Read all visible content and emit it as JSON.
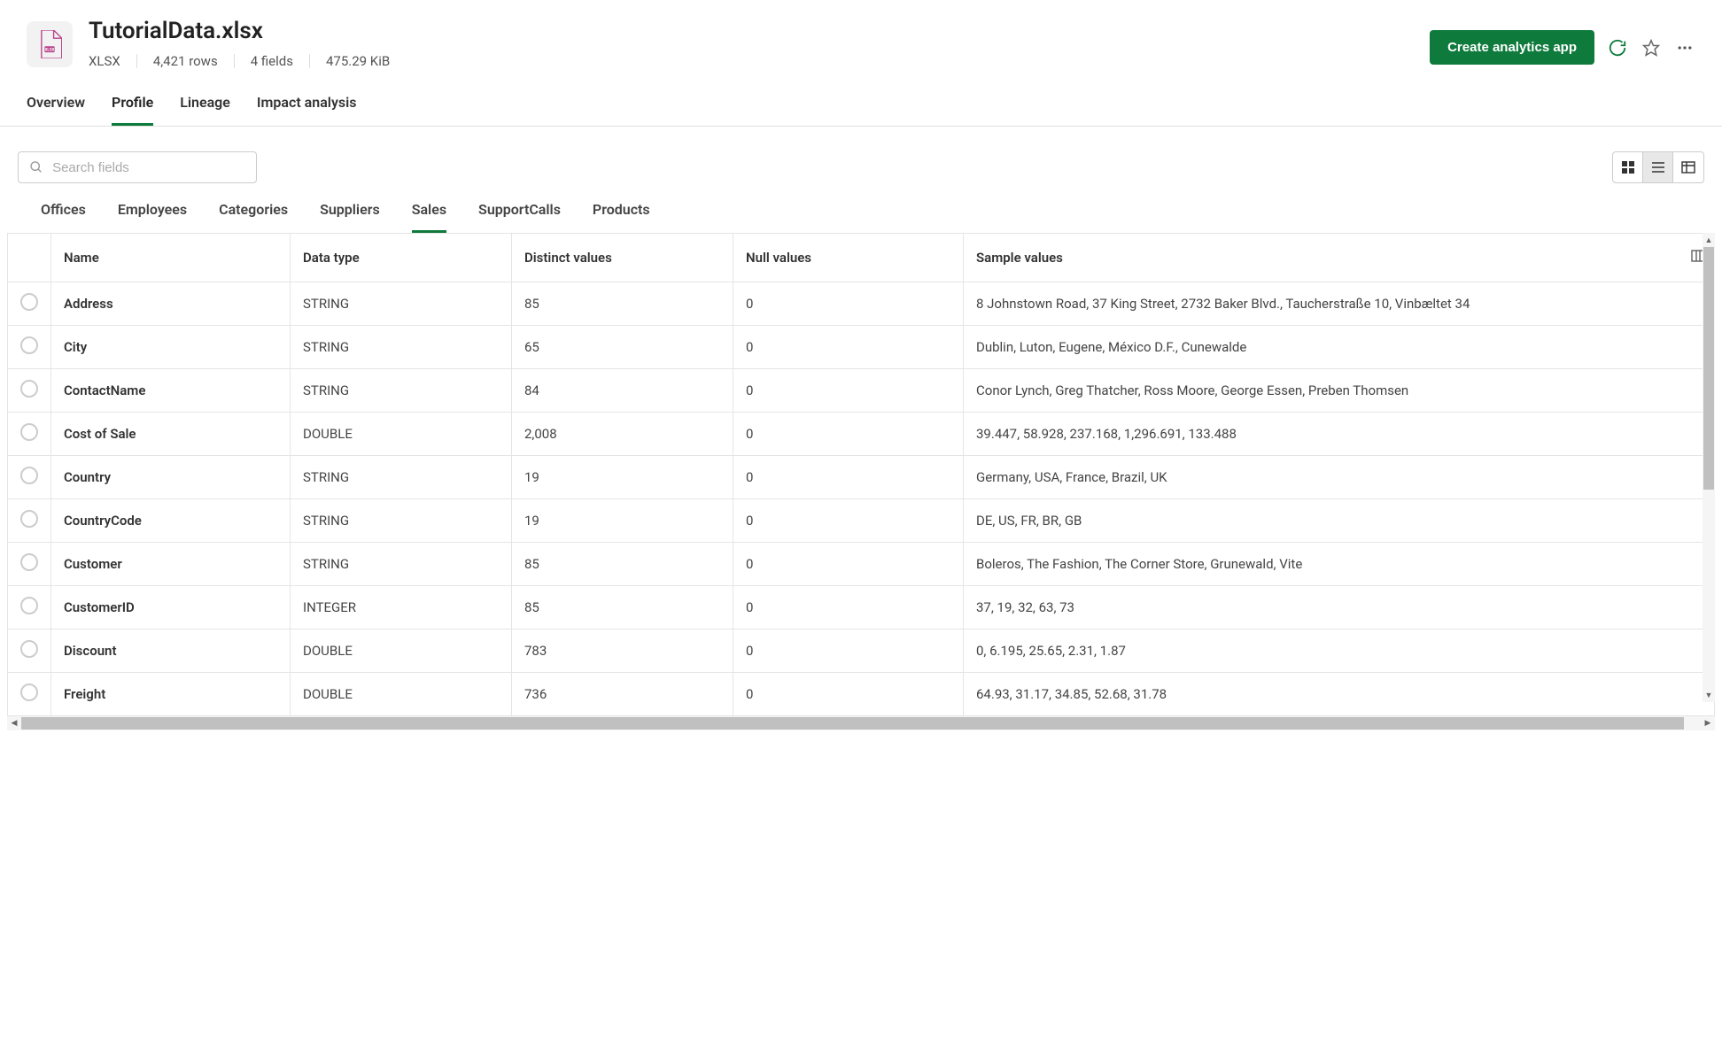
{
  "header": {
    "title": "TutorialData.xlsx",
    "file_type": "XLSX",
    "rows": "4,421 rows",
    "fields": "4 fields",
    "size": "475.29 KiB",
    "create_btn": "Create analytics app"
  },
  "main_tabs": [
    {
      "label": "Overview",
      "active": false
    },
    {
      "label": "Profile",
      "active": true
    },
    {
      "label": "Lineage",
      "active": false
    },
    {
      "label": "Impact analysis",
      "active": false
    }
  ],
  "search": {
    "placeholder": "Search fields"
  },
  "sheet_tabs": [
    {
      "label": "Offices",
      "active": false
    },
    {
      "label": "Employees",
      "active": false
    },
    {
      "label": "Categories",
      "active": false
    },
    {
      "label": "Suppliers",
      "active": false
    },
    {
      "label": "Sales",
      "active": true
    },
    {
      "label": "SupportCalls",
      "active": false
    },
    {
      "label": "Products",
      "active": false
    }
  ],
  "table": {
    "columns": [
      "Name",
      "Data type",
      "Distinct values",
      "Null values",
      "Sample values"
    ],
    "rows": [
      {
        "name": "Address",
        "type": "STRING",
        "distinct": "85",
        "nulls": "0",
        "sample": "8 Johnstown Road, 37 King Street, 2732 Baker Blvd., Taucherstraße 10, Vinbæltet 34"
      },
      {
        "name": "City",
        "type": "STRING",
        "distinct": "65",
        "nulls": "0",
        "sample": "Dublin, Luton, Eugene, México D.F., Cunewalde"
      },
      {
        "name": "ContactName",
        "type": "STRING",
        "distinct": "84",
        "nulls": "0",
        "sample": "Conor Lynch, Greg Thatcher, Ross Moore, George Essen, Preben Thomsen"
      },
      {
        "name": "Cost of Sale",
        "type": "DOUBLE",
        "distinct": "2,008",
        "nulls": "0",
        "sample": "39.447, 58.928, 237.168, 1,296.691, 133.488"
      },
      {
        "name": "Country",
        "type": "STRING",
        "distinct": "19",
        "nulls": "0",
        "sample": "Germany, USA, France, Brazil, UK"
      },
      {
        "name": "CountryCode",
        "type": "STRING",
        "distinct": "19",
        "nulls": "0",
        "sample": "DE, US, FR, BR, GB"
      },
      {
        "name": "Customer",
        "type": "STRING",
        "distinct": "85",
        "nulls": "0",
        "sample": "Boleros, The Fashion, The Corner Store, Grunewald, Vite"
      },
      {
        "name": "CustomerID",
        "type": "INTEGER",
        "distinct": "85",
        "nulls": "0",
        "sample": "37, 19, 32, 63, 73"
      },
      {
        "name": "Discount",
        "type": "DOUBLE",
        "distinct": "783",
        "nulls": "0",
        "sample": "0, 6.195, 25.65, 2.31, 1.87"
      },
      {
        "name": "Freight",
        "type": "DOUBLE",
        "distinct": "736",
        "nulls": "0",
        "sample": "64.93, 31.17, 34.85, 52.68, 31.78"
      }
    ]
  }
}
